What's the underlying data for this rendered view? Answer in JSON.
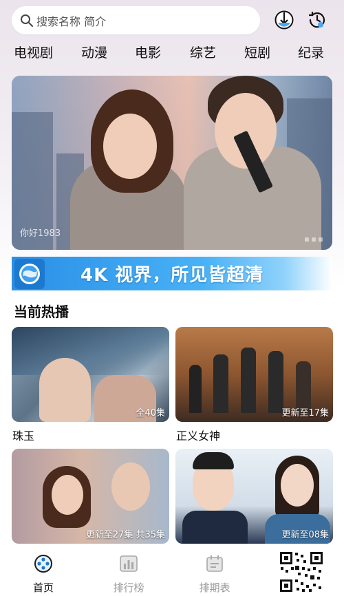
{
  "search": {
    "placeholder": "搜索名称 简介"
  },
  "top_icons": [
    "download-icon",
    "history-icon"
  ],
  "categories": [
    "电视剧",
    "动漫",
    "电影",
    "综艺",
    "短剧",
    "纪录"
  ],
  "banner": {
    "caption": "你好1983"
  },
  "ad": {
    "text": "4K 视界，所见皆超清"
  },
  "section": {
    "title": "当前热播"
  },
  "cards": [
    {
      "title": "珠玉",
      "badge": "全40集"
    },
    {
      "title": "正义女神",
      "badge": "更新至17集"
    },
    {
      "title": "",
      "badge": "更新至27集 共35集"
    },
    {
      "title": "",
      "badge": "更新至08集"
    }
  ],
  "bottom_nav": [
    {
      "label": "首页",
      "icon": "film-reel-icon",
      "active": true
    },
    {
      "label": "排行榜",
      "icon": "ranking-icon",
      "active": false
    },
    {
      "label": "排期表",
      "icon": "calendar-icon",
      "active": false
    }
  ],
  "colors": {
    "accent": "#1d79d0",
    "inactive": "#9a9a9a"
  }
}
